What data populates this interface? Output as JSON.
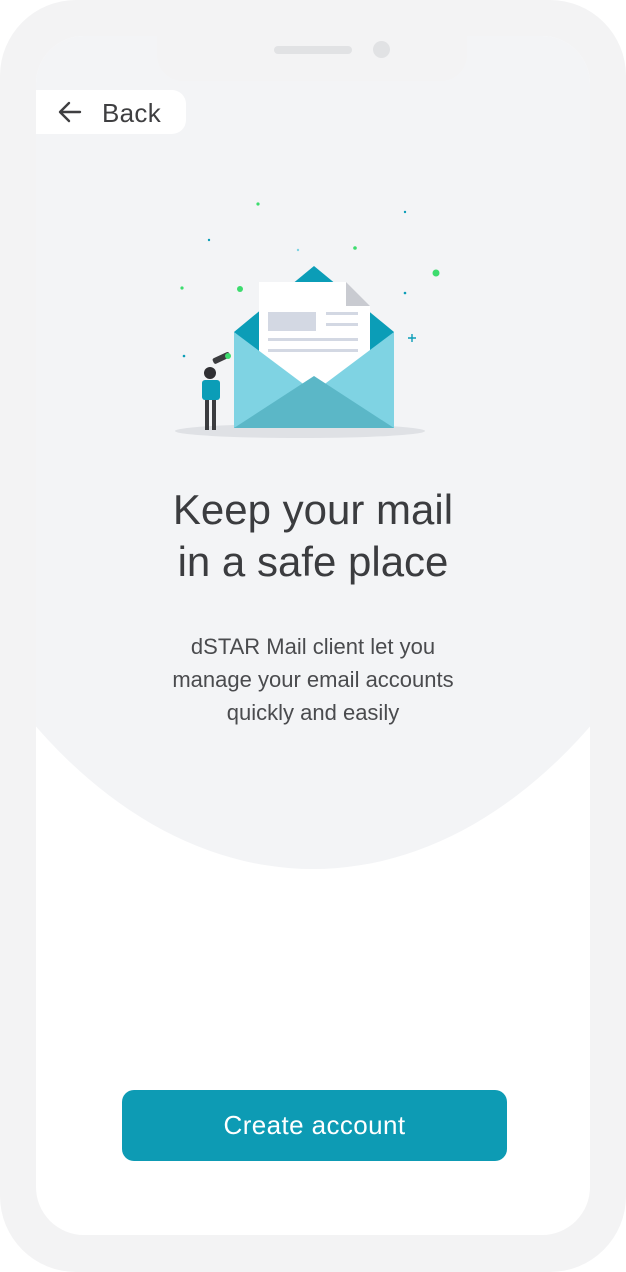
{
  "nav": {
    "back_label": "Back",
    "back_icon": "arrow-left-icon"
  },
  "illustration": {
    "icon": "open-envelope-letter-illustration"
  },
  "onboarding": {
    "title_line1": "Keep your mail",
    "title_line2": "in a safe place",
    "description_line1": "dSTAR Mail client let you",
    "description_line2": "manage your email accounts",
    "description_line3": "quickly and easily"
  },
  "actions": {
    "create_account_label": "Create account"
  },
  "colors": {
    "accent": "#0d9bb4",
    "envelope_light": "#7fd3e3",
    "envelope_dark": "#0b9db7",
    "screen_background": "#f3f4f6",
    "frame": "#f3f3f4",
    "sparkle_green": "#3ddc6e"
  }
}
